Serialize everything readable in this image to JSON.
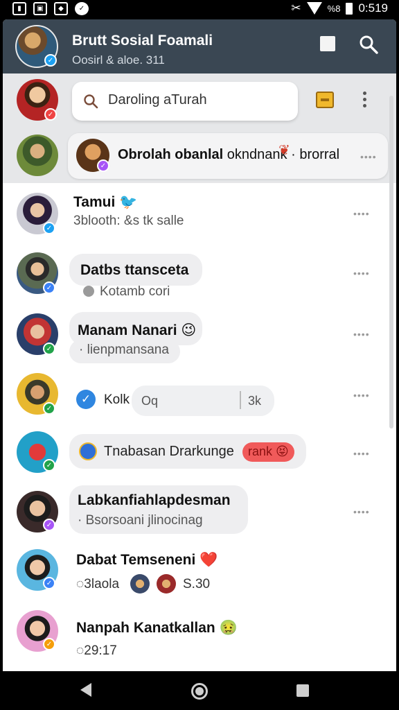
{
  "status_bar": {
    "time": "0:519",
    "battery_label": "%8",
    "icons": [
      "sim-icon",
      "photo-icon",
      "game-icon",
      "check-icon",
      "mute-icon",
      "wifi-icon",
      "battery-icon"
    ]
  },
  "header": {
    "title": "Brutt Sosial Foamali",
    "subtitle": "Oosirl & aloe. 311",
    "accent": "#3a4753"
  },
  "search": {
    "value": "Daroling aTurah"
  },
  "pinned": {
    "name": "Obrolah obanlal",
    "preview": " okndnank · brorral"
  },
  "chats": [
    {
      "name": "Tamui",
      "emoji": "🐦",
      "preview": "3blooth: &s tk salle",
      "badge_color": "#1da1f2"
    },
    {
      "name": "Datbs ttansceta",
      "preview": "Kotamb cori",
      "badge_color": "#3b82f6"
    },
    {
      "name": "Manam Nanari",
      "emoji": "😉",
      "preview": "· lienpmansana",
      "badge_color": "#22a34a"
    },
    {
      "name": "Kolk",
      "field_prefix": "Oq",
      "field_suffix": "3k",
      "badge_color": "#22a34a"
    },
    {
      "name": "Tnabasan Drarkunge",
      "tag": "rank 😝",
      "badge_color": "#22a34a"
    },
    {
      "name": "Labkanfiahlapdesman",
      "preview": "· Bsorsoani jlinocinag",
      "badge_color": "#a855f7"
    },
    {
      "name": "Dabat Temseneni",
      "emoji": "❤️",
      "preview": "3laola",
      "price": "S.30",
      "badge_color": "#3b82f6"
    },
    {
      "name": "Nanpah Kanatkallan",
      "emoji": "🤢",
      "preview": "29:17",
      "badge_color": "#f59e0b"
    }
  ],
  "more_label": "••••"
}
